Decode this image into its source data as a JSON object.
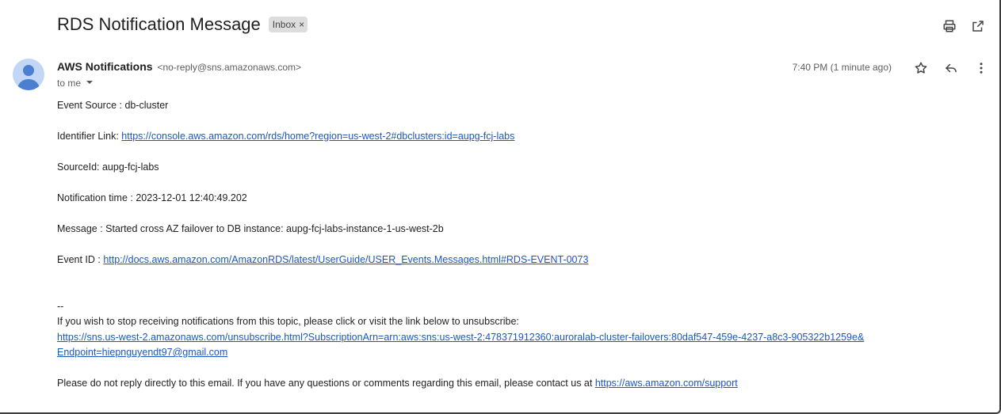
{
  "subject": "RDS Notification Message",
  "label": "Inbox",
  "label_close": "×",
  "sender": {
    "name": "AWS Notifications",
    "email": "<no-reply@sns.amazonaws.com>"
  },
  "recipient": "to me",
  "time": "7:40 PM (1 minute ago)",
  "body": {
    "event_source": "Event Source : db-cluster",
    "identifier_label": "Identifier Link: ",
    "identifier_link": "https://console.aws.amazon.com/rds/home?region=us-west-2#dbclusters:id=aupg-fcj-labs",
    "source_id": "SourceId: aupg-fcj-labs",
    "notification_time": "Notification time : 2023-12-01 12:40:49.202",
    "message": "Message : Started cross AZ failover to DB instance: aupg-fcj-labs-instance-1-us-west-2b",
    "event_id_label": "Event ID : ",
    "event_id_link": "http://docs.aws.amazon.com/AmazonRDS/latest/UserGuide/USER_Events.Messages.html#RDS-EVENT-0073",
    "separator": "--",
    "unsubscribe_text": "If you wish to stop receiving notifications from this topic, please click or visit the link below to unsubscribe:",
    "unsubscribe_link_1": "https://sns.us-west-2.amazonaws.com/unsubscribe.html?SubscriptionArn=arn:aws:sns:us-west-2:478371912360:auroralab-cluster-failovers:80daf547-459e-4237-a8c3-905322b1259e&",
    "unsubscribe_link_2": "Endpoint=hiepnguyendt97@gmail.com",
    "footer_text": "Please do not reply directly to this email. If you have any questions or comments regarding this email, please contact us at ",
    "footer_link": "https://aws.amazon.com/support"
  },
  "icons": [
    "print-icon",
    "open-in-new-icon",
    "star-icon",
    "reply-icon",
    "more-vert-icon",
    "avatar-icon",
    "chevron-down-icon"
  ],
  "colors": {
    "link": "#1a56c9",
    "avatar_bg": "#c2d7f5",
    "avatar_fg": "#4a7fd1",
    "chip_bg": "#dddddd"
  }
}
